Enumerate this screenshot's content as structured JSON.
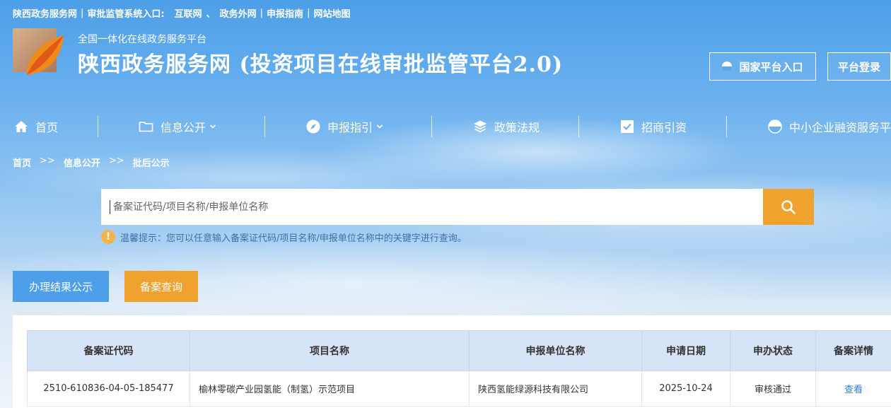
{
  "topbar": {
    "site": "陕西政务服务网",
    "entry_label": "审批监管系统入口:",
    "internet": "互联网",
    "comma": "、",
    "gov_net": "政务外网",
    "guide": "申报指南",
    "sitemap": "网站地图",
    "pipe": "|"
  },
  "brand": {
    "subtitle": "全国一体化在线政务服务平台",
    "title": "陕西政务服务网 (投资项目在线审批监管平台2.0)"
  },
  "header_buttons": {
    "national": "国家平台入口",
    "login": "平台登录"
  },
  "nav": [
    {
      "label": "首页",
      "icon": "home-icon"
    },
    {
      "label": "信息公开",
      "icon": "folder-icon"
    },
    {
      "label": "申报指引",
      "icon": "compass-icon"
    },
    {
      "label": "政策法规",
      "icon": "layers-icon"
    },
    {
      "label": "招商引资",
      "icon": "checkbox-icon"
    },
    {
      "label": "中小企业融资服务平",
      "icon": "half-circle-icon"
    }
  ],
  "breadcrumb": {
    "home": "首页",
    "info": "信息公开",
    "current": "批后公示",
    "sep": ">>"
  },
  "search": {
    "placeholder": "备案证代码/项目名称/申报单位名称"
  },
  "tip": {
    "mark": "!",
    "text": "温馨提示：您可以任意输入备案证代码/项目名称/申报单位名称中的关键字进行查询。"
  },
  "tabs": {
    "result": "办理结果公示",
    "query": "备案查询"
  },
  "table": {
    "headers": [
      "备案证代码",
      "项目名称",
      "申报单位名称",
      "申请日期",
      "申办状态",
      "备案详情"
    ],
    "rows": [
      {
        "code": "2510-610836-04-05-185477",
        "project": "榆林零碳产业园氢能（制氢）示范项目",
        "unit": "陕西氢能绿源科技有限公司",
        "date": "2025-10-24",
        "status": "审核通过",
        "detail": "查看"
      }
    ]
  },
  "colors": {
    "accent_orange": "#f0a22e",
    "accent_blue": "#4c9fe8",
    "header_row": "#d6e4f7",
    "link": "#2f7fd8"
  }
}
